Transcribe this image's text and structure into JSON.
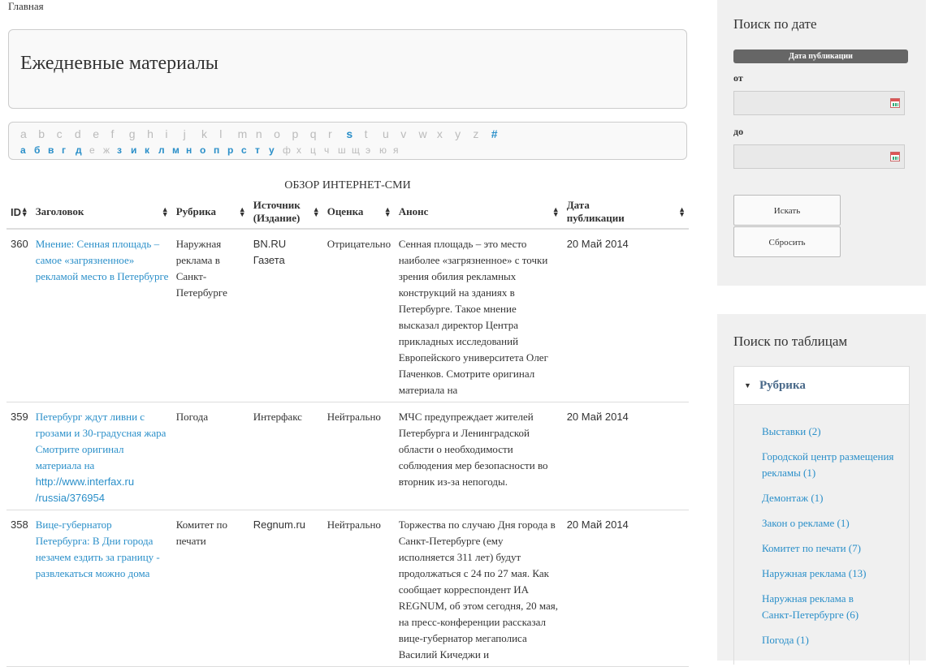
{
  "breadcrumb": "Главная",
  "page_title": "Ежедневные материалы",
  "glossary": {
    "latin": [
      {
        "c": "a",
        "on": false
      },
      {
        "c": "b",
        "on": false
      },
      {
        "c": "c",
        "on": false
      },
      {
        "c": "d",
        "on": false
      },
      {
        "c": "e",
        "on": false
      },
      {
        "c": "f",
        "on": false
      },
      {
        "c": "g",
        "on": false
      },
      {
        "c": "h",
        "on": false
      },
      {
        "c": "i",
        "on": false
      },
      {
        "c": "j",
        "on": false
      },
      {
        "c": "k",
        "on": false
      },
      {
        "c": "l",
        "on": false
      },
      {
        "c": "m",
        "on": false
      },
      {
        "c": "n",
        "on": false
      },
      {
        "c": "o",
        "on": false
      },
      {
        "c": "p",
        "on": false
      },
      {
        "c": "q",
        "on": false
      },
      {
        "c": "r",
        "on": false
      },
      {
        "c": "s",
        "on": true
      },
      {
        "c": "t",
        "on": false
      },
      {
        "c": "u",
        "on": false
      },
      {
        "c": "v",
        "on": false
      },
      {
        "c": "w",
        "on": false
      },
      {
        "c": "x",
        "on": false
      },
      {
        "c": "y",
        "on": false
      },
      {
        "c": "z",
        "on": false
      },
      {
        "c": "#",
        "on": true
      }
    ],
    "cyrillic": [
      {
        "c": "а",
        "on": true
      },
      {
        "c": "б",
        "on": true
      },
      {
        "c": "в",
        "on": true
      },
      {
        "c": "г",
        "on": true
      },
      {
        "c": "д",
        "on": true
      },
      {
        "c": "е",
        "on": false
      },
      {
        "c": "ж",
        "on": false
      },
      {
        "c": "з",
        "on": true
      },
      {
        "c": "и",
        "on": true
      },
      {
        "c": "к",
        "on": true
      },
      {
        "c": "л",
        "on": true
      },
      {
        "c": "м",
        "on": true
      },
      {
        "c": "н",
        "on": true
      },
      {
        "c": "о",
        "on": true
      },
      {
        "c": "п",
        "on": true
      },
      {
        "c": "р",
        "on": true
      },
      {
        "c": "с",
        "on": true
      },
      {
        "c": "т",
        "on": true
      },
      {
        "c": "у",
        "on": true
      },
      {
        "c": "ф",
        "on": false
      },
      {
        "c": "х",
        "on": false
      },
      {
        "c": "ц",
        "on": false
      },
      {
        "c": "ч",
        "on": false
      },
      {
        "c": "ш",
        "on": false
      },
      {
        "c": "щ",
        "on": false
      },
      {
        "c": "э",
        "on": false
      },
      {
        "c": "ю",
        "on": false
      },
      {
        "c": "я",
        "on": false
      }
    ]
  },
  "table": {
    "caption": "ОБЗОР ИНТЕРНЕТ-СМИ",
    "headers": [
      "ID",
      "Заголовок",
      "Рубрика",
      "Источник (Издание)",
      "Оценка",
      "Анонс",
      "Дата публикации"
    ],
    "rows": [
      {
        "id": "360",
        "title": "Мнение: Сенная площадь – самое «загрязненное» рекламой место в Петербурге",
        "rubric": "Наружная реклама в Санкт-Петербурге",
        "source": "BN.RU Газета",
        "rating": "Отрицательно",
        "anons": "Сенная площадь – это место наиболее «загрязненное» с точки зрения обилия рекламных конструкций на зданиях в Петербурге. Такое мнение высказал директор Центра прикладных исследований Европейского университета Олег Паченков. Смотрите оригинал материала на",
        "date": "20 Май 2014"
      },
      {
        "id": "359",
        "title": "Петербург ждут ливни с грозами и 30-градусная жара Смотрите оригинал материала на",
        "title_url": "http://www.interfax.ru /russia/376954",
        "rubric": "Погода",
        "source": "Интерфакс",
        "rating": "Нейтрально",
        "anons": "МЧС предупреждает жителей Петербурга и Ленинградской области о необходимости соблюдения мер безопасности во вторник из-за непогоды.",
        "date": "20 Май 2014"
      },
      {
        "id": "358",
        "title": "Вице-губернатор Петербурга: В Дни города незачем ездить за границу - развлекаться можно дома",
        "rubric": "Комитет по печати",
        "source": "Regnum.ru",
        "rating": "Нейтрально",
        "anons": "Торжества по случаю Дня города в Санкт-Петербурге (ему исполняется 311 лет) будут продолжаться с 24 по 27 мая. Как сообщает корреспондент ИА REGNUM, об этом сегодня, 20 мая, на пресс-конференции рассказал вице-губернатор мегаполиса Василий Кичеджи и",
        "date": "20 Май 2014"
      }
    ]
  },
  "date_search": {
    "title": "Поиск по дате",
    "header": "Дата публикации",
    "from_label": "от",
    "to_label": "до",
    "from_value": "",
    "to_value": "",
    "search_button": "Искать",
    "reset_button": "Сбросить"
  },
  "table_search": {
    "title": "Поиск по таблицам",
    "group_label": "Рубрика",
    "items": [
      "Выставки (2)",
      "Городской центр размещения рекламы (1)",
      "Демонтаж (1)",
      "Закон о рекламе (1)",
      "Комитет по печати (7)",
      "Наружная реклама (13)",
      "Наружная реклама в Санкт-Петербурге (6)",
      "Погода (1)"
    ]
  },
  "colors": {
    "link": "#2a8fc9",
    "disabled": "#bbbbbb",
    "sidebar_bg": "#f0f0f0",
    "date_header_bg": "#666666"
  }
}
